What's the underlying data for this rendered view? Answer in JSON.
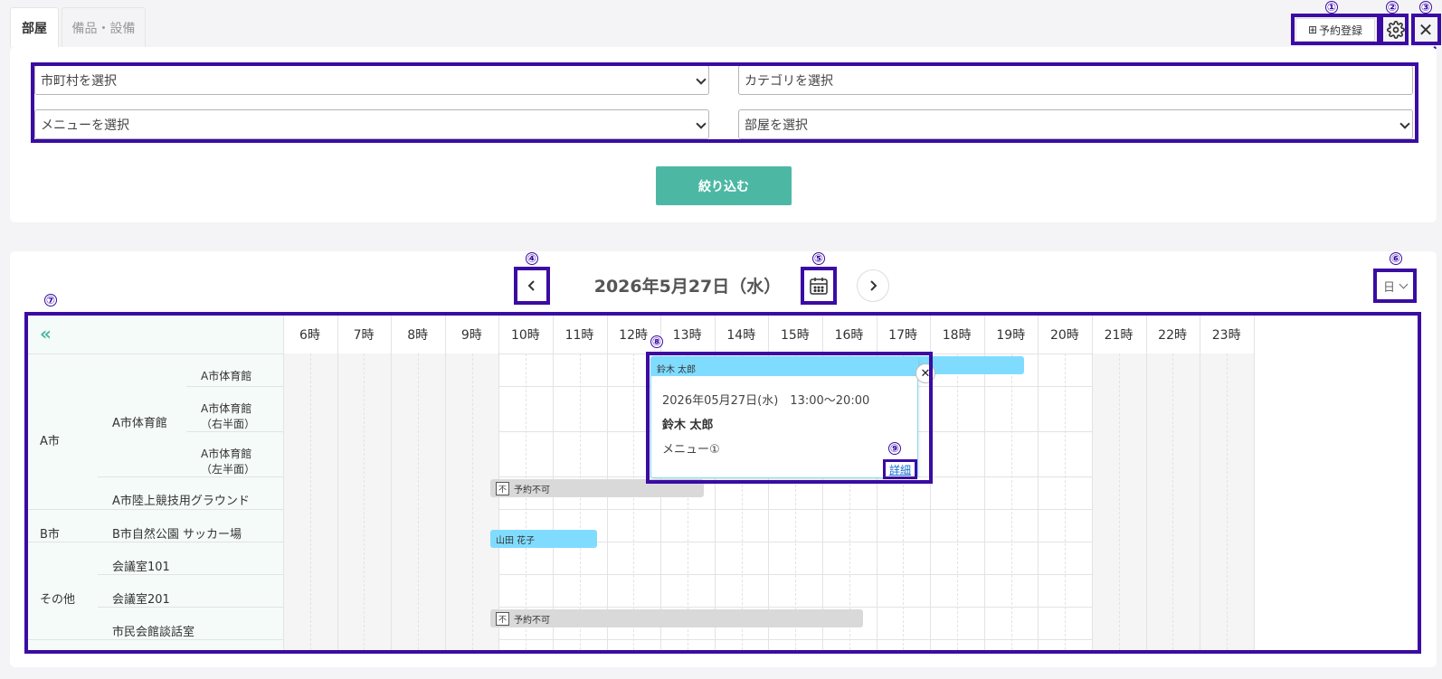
{
  "tabs": [
    "部屋",
    "備品・設備"
  ],
  "header": {
    "reserve_button": "予約登録"
  },
  "filters": {
    "city": "市町村を選択",
    "category": "カテゴリを選択",
    "menu": "メニューを選択",
    "room": "部屋を選択",
    "submit": "絞り込む"
  },
  "calendar": {
    "date_title": "2026年5月27日（水）",
    "view": "日",
    "collapse": "«",
    "hours": [
      "6時",
      "7時",
      "8時",
      "9時",
      "10時",
      "11時",
      "12時",
      "13時",
      "14時",
      "15時",
      "16時",
      "17時",
      "18時",
      "19時",
      "20時",
      "21時",
      "22時",
      "23時"
    ],
    "rows": [
      {
        "group": "A市",
        "facility": "A市体育館",
        "rooms": [
          "A市体育館",
          "A市体育館（右半面）",
          "A市体育館（左半面）"
        ]
      },
      {
        "group": "",
        "facility": "A市陸上競技用グラウンド"
      },
      {
        "group": "B市",
        "facility": "B市自然公園 サッカー場"
      },
      {
        "group": "その他",
        "facility": "会議室101"
      },
      {
        "group": "",
        "facility": "会議室201"
      },
      {
        "group": "",
        "facility": "市民会館談話室"
      }
    ],
    "events": [
      {
        "label": "鈴木 太郎",
        "color": "#80dcff"
      },
      {
        "label": "予約不可",
        "badge": "不",
        "color": "#d9d9d9"
      },
      {
        "label": "山田 花子",
        "color": "#80dcff"
      },
      {
        "label": "予約不可",
        "badge": "不",
        "color": "#d9d9d9"
      }
    ]
  },
  "popup": {
    "datetime": "2026年05月27日(水)　13:00〜20:00",
    "name": "鈴木 太郎",
    "menu": "メニュー①",
    "detail": "詳細",
    "close": "✕"
  },
  "annotations": [
    "①",
    "②",
    "③",
    "④",
    "⑤",
    "⑥",
    "⑦",
    "⑧",
    "⑨"
  ],
  "highlight_color": "#3a0ca3",
  "accent_color": "#4cb8a4"
}
